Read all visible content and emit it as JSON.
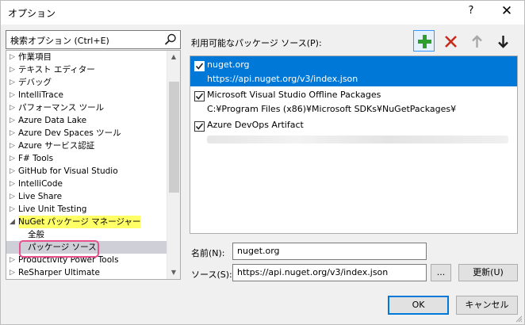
{
  "window": {
    "title": "オプション",
    "help": "?",
    "close": "✕"
  },
  "search": {
    "text": "検索オプション (Ctrl+E)"
  },
  "tree": {
    "items": [
      {
        "arrow": "▷",
        "label": "作業項目"
      },
      {
        "arrow": "▷",
        "label": "テキスト エディター"
      },
      {
        "arrow": "▷",
        "label": "デバッグ"
      },
      {
        "arrow": "▷",
        "label": "IntelliTrace"
      },
      {
        "arrow": "▷",
        "label": "パフォーマンス ツール"
      },
      {
        "arrow": "▷",
        "label": "Azure Data Lake"
      },
      {
        "arrow": "▷",
        "label": "Azure Dev Spaces ツール"
      },
      {
        "arrow": "▷",
        "label": "Azure サービス認証"
      },
      {
        "arrow": "▷",
        "label": "F# Tools"
      },
      {
        "arrow": "▷",
        "label": "GitHub for Visual Studio"
      },
      {
        "arrow": "▷",
        "label": "IntelliCode"
      },
      {
        "arrow": "▷",
        "label": "Live Share"
      },
      {
        "arrow": "▷",
        "label": "Live Unit Testing"
      },
      {
        "arrow": "◢",
        "label": "NuGet パッケージ マネージャー"
      },
      {
        "arrow": "",
        "label": "全般"
      },
      {
        "arrow": "",
        "label": "パッケージ ソース"
      },
      {
        "arrow": "▷",
        "label": "Productivity Power Tools"
      },
      {
        "arrow": "▷",
        "label": "ReSharper Ultimate"
      }
    ]
  },
  "sources": {
    "label": "利用可能なパッケージ ソース(P):",
    "items": [
      {
        "name": "nuget.org",
        "url": "https://api.nuget.org/v3/index.json",
        "checked": true
      },
      {
        "name": "Microsoft Visual Studio Offline Packages",
        "url": "C:¥Program Files (x86)¥Microsoft SDKs¥NuGetPackages¥",
        "checked": true
      },
      {
        "name": "Azure DevOps Artifact",
        "url": "",
        "checked": true
      }
    ]
  },
  "form": {
    "name_label": "名前(N):",
    "name_value": "nuget.org",
    "source_label": "ソース(S):",
    "source_value": "https://api.nuget.org/v3/index.json",
    "browse_label": "...",
    "update_label": "更新(U)"
  },
  "footer": {
    "ok_label": "OK",
    "cancel_label": "キャンセル"
  },
  "colors": {
    "accent": "#0078d7",
    "add_green": "#2e9e2e",
    "remove_red": "#c42b1c",
    "highlight_yellow": "#ffff66",
    "annotation_pink": "#e8508e"
  }
}
